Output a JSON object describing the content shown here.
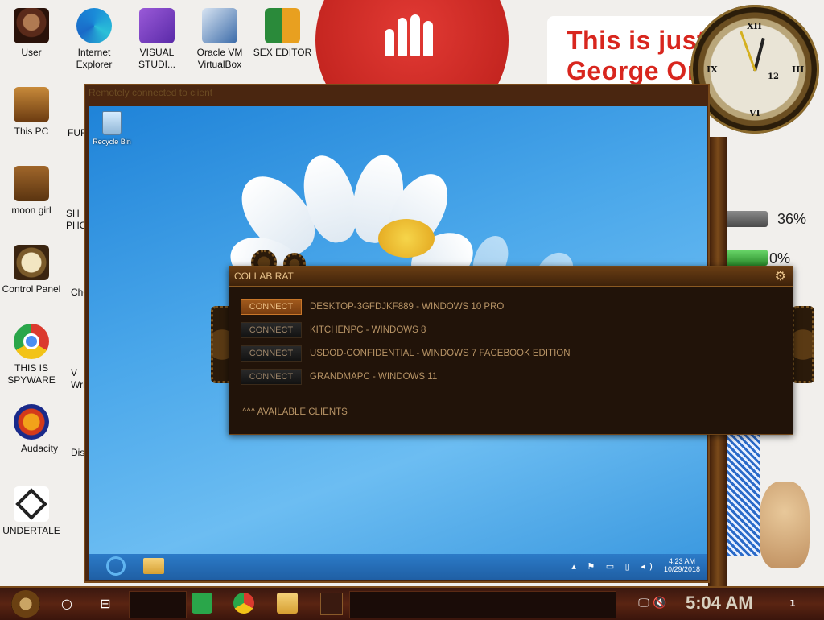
{
  "desktop": {
    "icons": [
      {
        "name": "user",
        "label": "User"
      },
      {
        "name": "internet-explorer",
        "label": "Internet Explorer"
      },
      {
        "name": "visual-studio",
        "label": "VISUAL STUDI..."
      },
      {
        "name": "oracle-vm-virtualbox",
        "label": "Oracle VM VirtualBox"
      },
      {
        "name": "sex-editor",
        "label": "SEX EDITOR"
      },
      {
        "name": "this-pc",
        "label": "This PC"
      },
      {
        "name": "moon-girl",
        "label": "moon girl"
      },
      {
        "name": "control-panel",
        "label": "Control Panel"
      },
      {
        "name": "chrome",
        "label": "THIS IS SPYWARE"
      },
      {
        "name": "audacity",
        "label": "Audacity"
      },
      {
        "name": "undertale",
        "label": "UNDERTALE"
      }
    ],
    "partial_labels": [
      "FUR",
      "SH PHC",
      "Cho",
      "V Wri",
      "Dis"
    ],
    "poster_lines": [
      "This is just",
      "George Orwell"
    ],
    "gauges": [
      "36%",
      "0%"
    ],
    "clock_numerals": [
      "XII",
      "III",
      "VI",
      "IX",
      "12"
    ]
  },
  "remote_window": {
    "title": "Remotely connected to client",
    "recycle_bin_label": "Recycle Bin",
    "tray_time": "4:23 AM",
    "tray_date": "10/29/2018",
    "tray_icons": "▴ ⚑ ▭ ▯ ◂)"
  },
  "rat_dialog": {
    "title": "COLLAB RAT",
    "gear_glyph": "⚙",
    "clients": [
      {
        "button": "CONNECT",
        "name": "DESKTOP-3GFDJKF889 - WINDOWS 10 PRO",
        "active": true
      },
      {
        "button": "CONNECT",
        "name": "KITCHENPC - WINDOWS 8",
        "active": false
      },
      {
        "button": "CONNECT",
        "name": "USDOD-CONFIDENTIAL - WINDOWS 7 FACEBOOK EDITION",
        "active": false
      },
      {
        "button": "CONNECT",
        "name": "GRANDMAPC - WINDOWS 11",
        "active": false
      }
    ],
    "footer": "^^^ AVAILABLE CLIENTS"
  },
  "taskbar": {
    "search_glyph": "○",
    "task_view_glyph": "⊟",
    "time": "5:04 AM",
    "notification_count": "1",
    "tray_glyphs": "🖵 🔇"
  },
  "colors": {
    "rat_bg": "#211309",
    "rat_accent": "#c9772a",
    "win8_blue": "#2c7bc8",
    "stop_red": "#c42520"
  }
}
